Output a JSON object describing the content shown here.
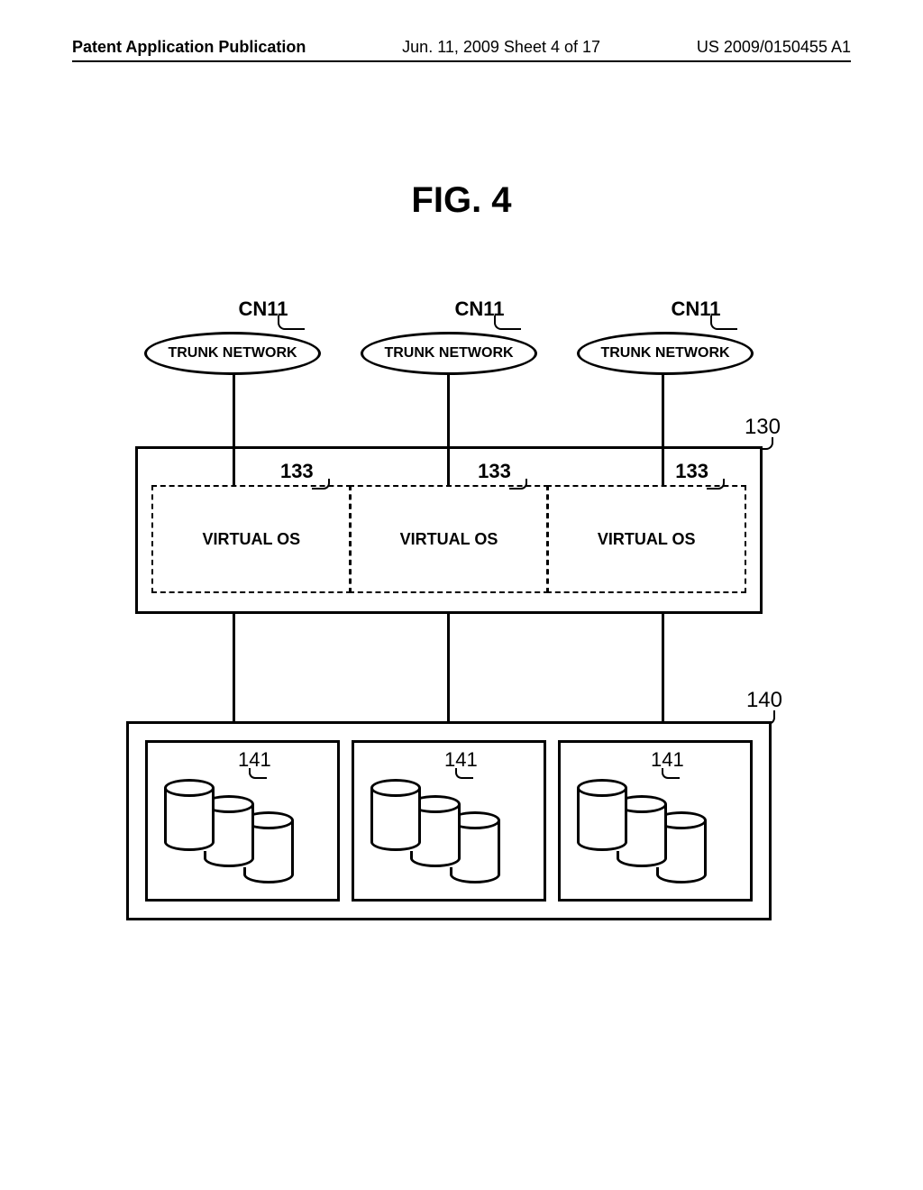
{
  "header": {
    "left": "Patent Application Publication",
    "center": "Jun. 11, 2009  Sheet 4 of 17",
    "right": "US 2009/0150455 A1"
  },
  "figure_title": "FIG. 4",
  "trunks": {
    "ref": "CN11",
    "label": "TRUNK NETWORK"
  },
  "box130": {
    "ref": "130",
    "vos_ref": "133",
    "vos_label": "VIRTUAL OS"
  },
  "box140": {
    "ref": "140",
    "storage_ref": "141"
  }
}
